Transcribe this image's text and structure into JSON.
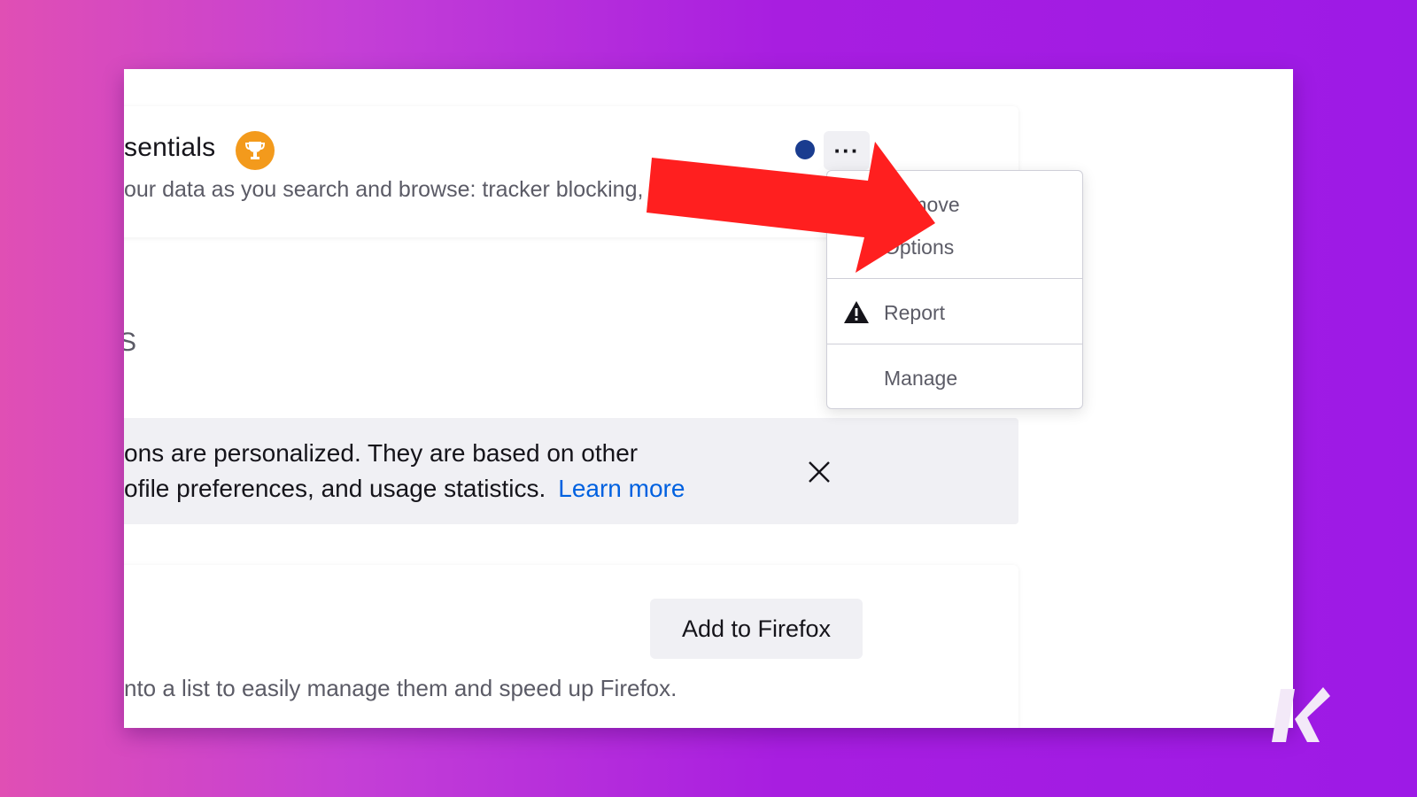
{
  "extension": {
    "name": "sentials",
    "description": "our data as you search and browse: tracker blocking, smarter en",
    "more_button_label": "···"
  },
  "section": {
    "letter": "S"
  },
  "notice": {
    "line1": "ons are personalized. They are based on other",
    "line2": "ofile preferences, and usage statistics.",
    "link": "Learn more"
  },
  "recommended": {
    "add_button": "Add to Firefox",
    "description": "nto a list to easily manage them and speed up Firefox."
  },
  "menu": {
    "remove": "Remove",
    "options": "Options",
    "report": "Report",
    "manage": "Manage"
  },
  "colors": {
    "arrow": "#ff1f1f",
    "badge": "#f39a1c",
    "link": "#0061e0"
  }
}
